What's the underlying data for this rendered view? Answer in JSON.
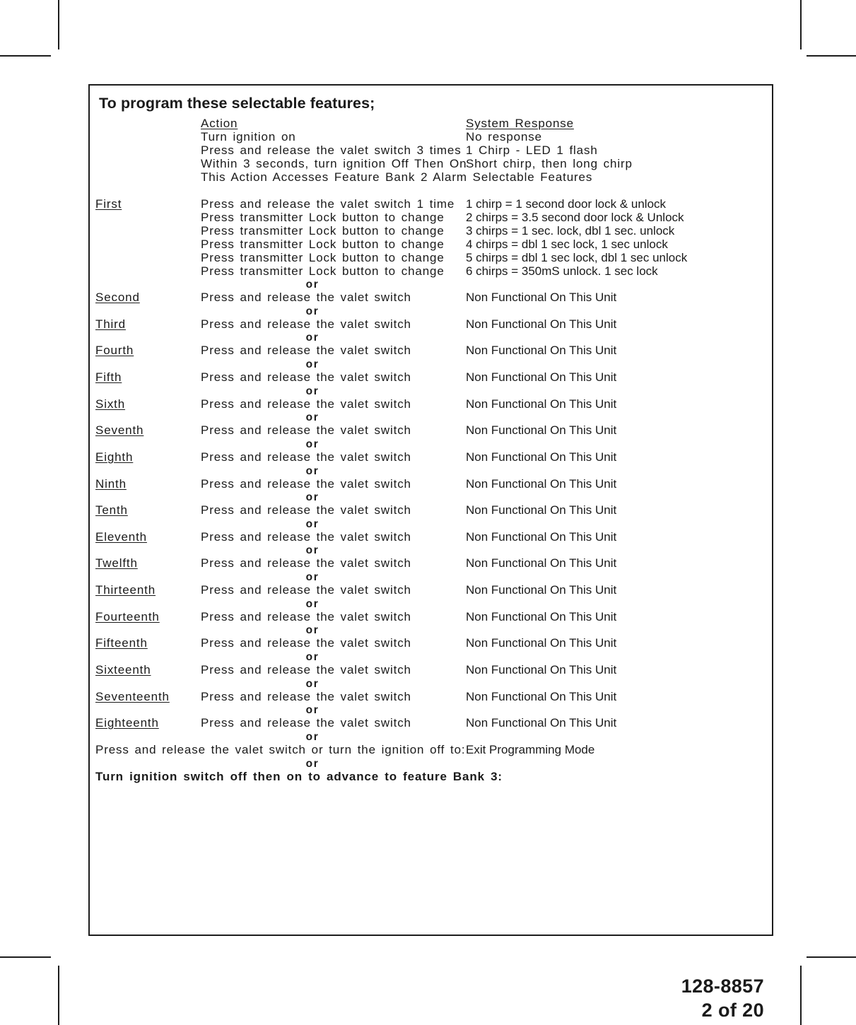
{
  "document": {
    "title": "To program these selectable features;",
    "part_number": "128-8857",
    "page_label": "2 of 20"
  },
  "columns": {
    "action_header": "Action",
    "response_header": "System Response"
  },
  "intro_rows": [
    {
      "action": "Turn ignition on",
      "response": "No response"
    },
    {
      "action": "Press and release the valet switch 3 times",
      "response": "1 Chirp - LED 1 flash"
    },
    {
      "action": "Within 3 seconds, turn ignition Off Then On",
      "response": "Short chirp, then long chirp"
    },
    {
      "action": "This Action Accesses Feature Bank 2 Alarm Selectable Features",
      "response": ""
    }
  ],
  "first_feature": {
    "ordinal": "First",
    "steps": [
      {
        "action": "Press and release the valet switch 1 time",
        "response": "1 chirp = 1 second door lock & unlock"
      },
      {
        "action": "Press transmitter Lock button to change",
        "response": "2 chirps = 3.5 second door lock & Unlock"
      },
      {
        "action": "Press transmitter Lock button to change",
        "response": "3 chirps = 1 sec. lock, dbl 1 sec. unlock"
      },
      {
        "action": "Press transmitter Lock button to change",
        "response": "4 chirps = dbl 1 sec lock, 1 sec unlock"
      },
      {
        "action": "Press transmitter Lock button to change",
        "response": "5 chirps = dbl 1 sec lock, dbl 1 sec unlock"
      },
      {
        "action": "Press transmitter Lock button to change",
        "response": "6 chirps = 350mS unlock. 1 sec lock"
      }
    ]
  },
  "separator_label": "or",
  "features": [
    {
      "ordinal": "Second",
      "action": "Press and release the valet switch",
      "response": "Non Functional On This Unit"
    },
    {
      "ordinal": "Third",
      "action": "Press and release the valet switch",
      "response": "Non Functional On This Unit"
    },
    {
      "ordinal": "Fourth",
      "action": "Press and release the valet switch",
      "response": "Non Functional On This Unit"
    },
    {
      "ordinal": "Fifth",
      "action": "Press and release the valet switch",
      "response": "Non Functional On This Unit"
    },
    {
      "ordinal": "Sixth",
      "action": "Press and release the valet switch",
      "response": "Non Functional On This Unit"
    },
    {
      "ordinal": "Seventh",
      "action": "Press and release the valet switch",
      "response": "Non Functional On This Unit"
    },
    {
      "ordinal": "Eighth",
      "action": "Press and release the valet switch",
      "response": "Non Functional On This Unit"
    },
    {
      "ordinal": "Ninth",
      "action": "Press and release the valet switch",
      "response": "Non Functional On This Unit"
    },
    {
      "ordinal": "Tenth",
      "action": "Press and release the valet switch",
      "response": "Non Functional On This Unit"
    },
    {
      "ordinal": "Eleventh",
      "action": "Press and release the valet switch",
      "response": "Non Functional On This Unit"
    },
    {
      "ordinal": "Twelfth",
      "action": "Press and release the valet switch",
      "response": "Non Functional On This Unit"
    },
    {
      "ordinal": "Thirteenth",
      "action": "Press and release the valet switch",
      "response": "Non Functional On This Unit"
    },
    {
      "ordinal": "Fourteenth",
      "action": "Press and release the valet switch",
      "response": "Non Functional On This Unit"
    },
    {
      "ordinal": "Fifteenth",
      "action": "Press and release the valet switch",
      "response": "Non Functional On This Unit"
    },
    {
      "ordinal": "Sixteenth",
      "action": "Press and release the valet switch",
      "response": "Non Functional On This Unit"
    },
    {
      "ordinal": "Seventeenth",
      "action": "Press and release the valet switch",
      "response": "Non Functional On This Unit"
    },
    {
      "ordinal": "Eighteenth",
      "action": "Press and release the valet switch",
      "response": "Non Functional On This Unit"
    }
  ],
  "exit_row": {
    "action": "Press and release the valet switch or turn the ignition off to:",
    "response": "Exit Programming Mode"
  },
  "advance_row": {
    "text": "Turn ignition switch off then on to advance to feature Bank 3:"
  }
}
